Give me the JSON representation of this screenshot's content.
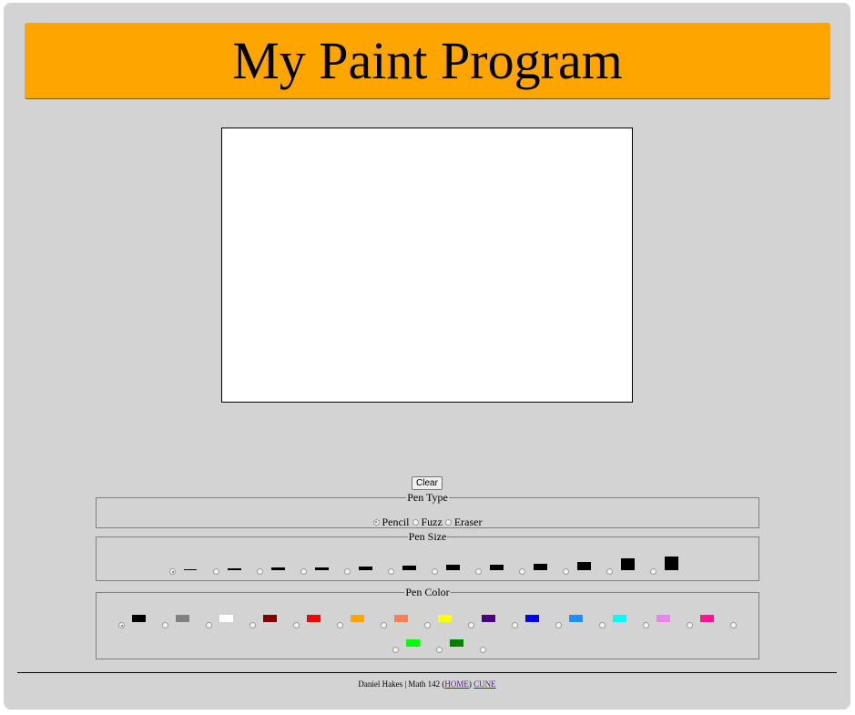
{
  "header": {
    "title": "My Paint Program"
  },
  "controls": {
    "clear_label": "Clear"
  },
  "pen_type": {
    "legend": "Pen Type",
    "options": [
      {
        "label": "Pencil",
        "selected": true
      },
      {
        "label": "Fuzz",
        "selected": false
      },
      {
        "label": "Eraser",
        "selected": false
      }
    ]
  },
  "pen_size": {
    "legend": "Pen Size",
    "options": [
      {
        "selected": true
      },
      {
        "selected": false
      },
      {
        "selected": false
      },
      {
        "selected": false
      },
      {
        "selected": false
      },
      {
        "selected": false
      },
      {
        "selected": false
      },
      {
        "selected": false
      },
      {
        "selected": false
      },
      {
        "selected": false
      },
      {
        "selected": false
      },
      {
        "selected": false
      }
    ]
  },
  "pen_color": {
    "legend": "Pen Color",
    "colors": [
      {
        "hex": "#000000",
        "selected": true
      },
      {
        "hex": "#808080",
        "selected": false
      },
      {
        "hex": "#ffffff",
        "selected": false
      },
      {
        "hex": "#800000",
        "selected": false
      },
      {
        "hex": "#ff0000",
        "selected": false
      },
      {
        "hex": "#ffa500",
        "selected": false
      },
      {
        "hex": "#ff7f50",
        "selected": false
      },
      {
        "hex": "#ffff00",
        "selected": false
      },
      {
        "hex": "#4b0082",
        "selected": false
      },
      {
        "hex": "#0000ff",
        "selected": false
      },
      {
        "hex": "#1e90ff",
        "selected": false
      },
      {
        "hex": "#00ffff",
        "selected": false
      },
      {
        "hex": "#ee82ee",
        "selected": false
      },
      {
        "hex": "#ff1493",
        "selected": false
      },
      {
        "hex": "#00ff00",
        "selected": false
      },
      {
        "hex": "#008000",
        "selected": false
      }
    ]
  },
  "footer": {
    "author": "Daniel Hakes | Math 142",
    "home_label": "HOME",
    "cune_label": "CUNE"
  }
}
